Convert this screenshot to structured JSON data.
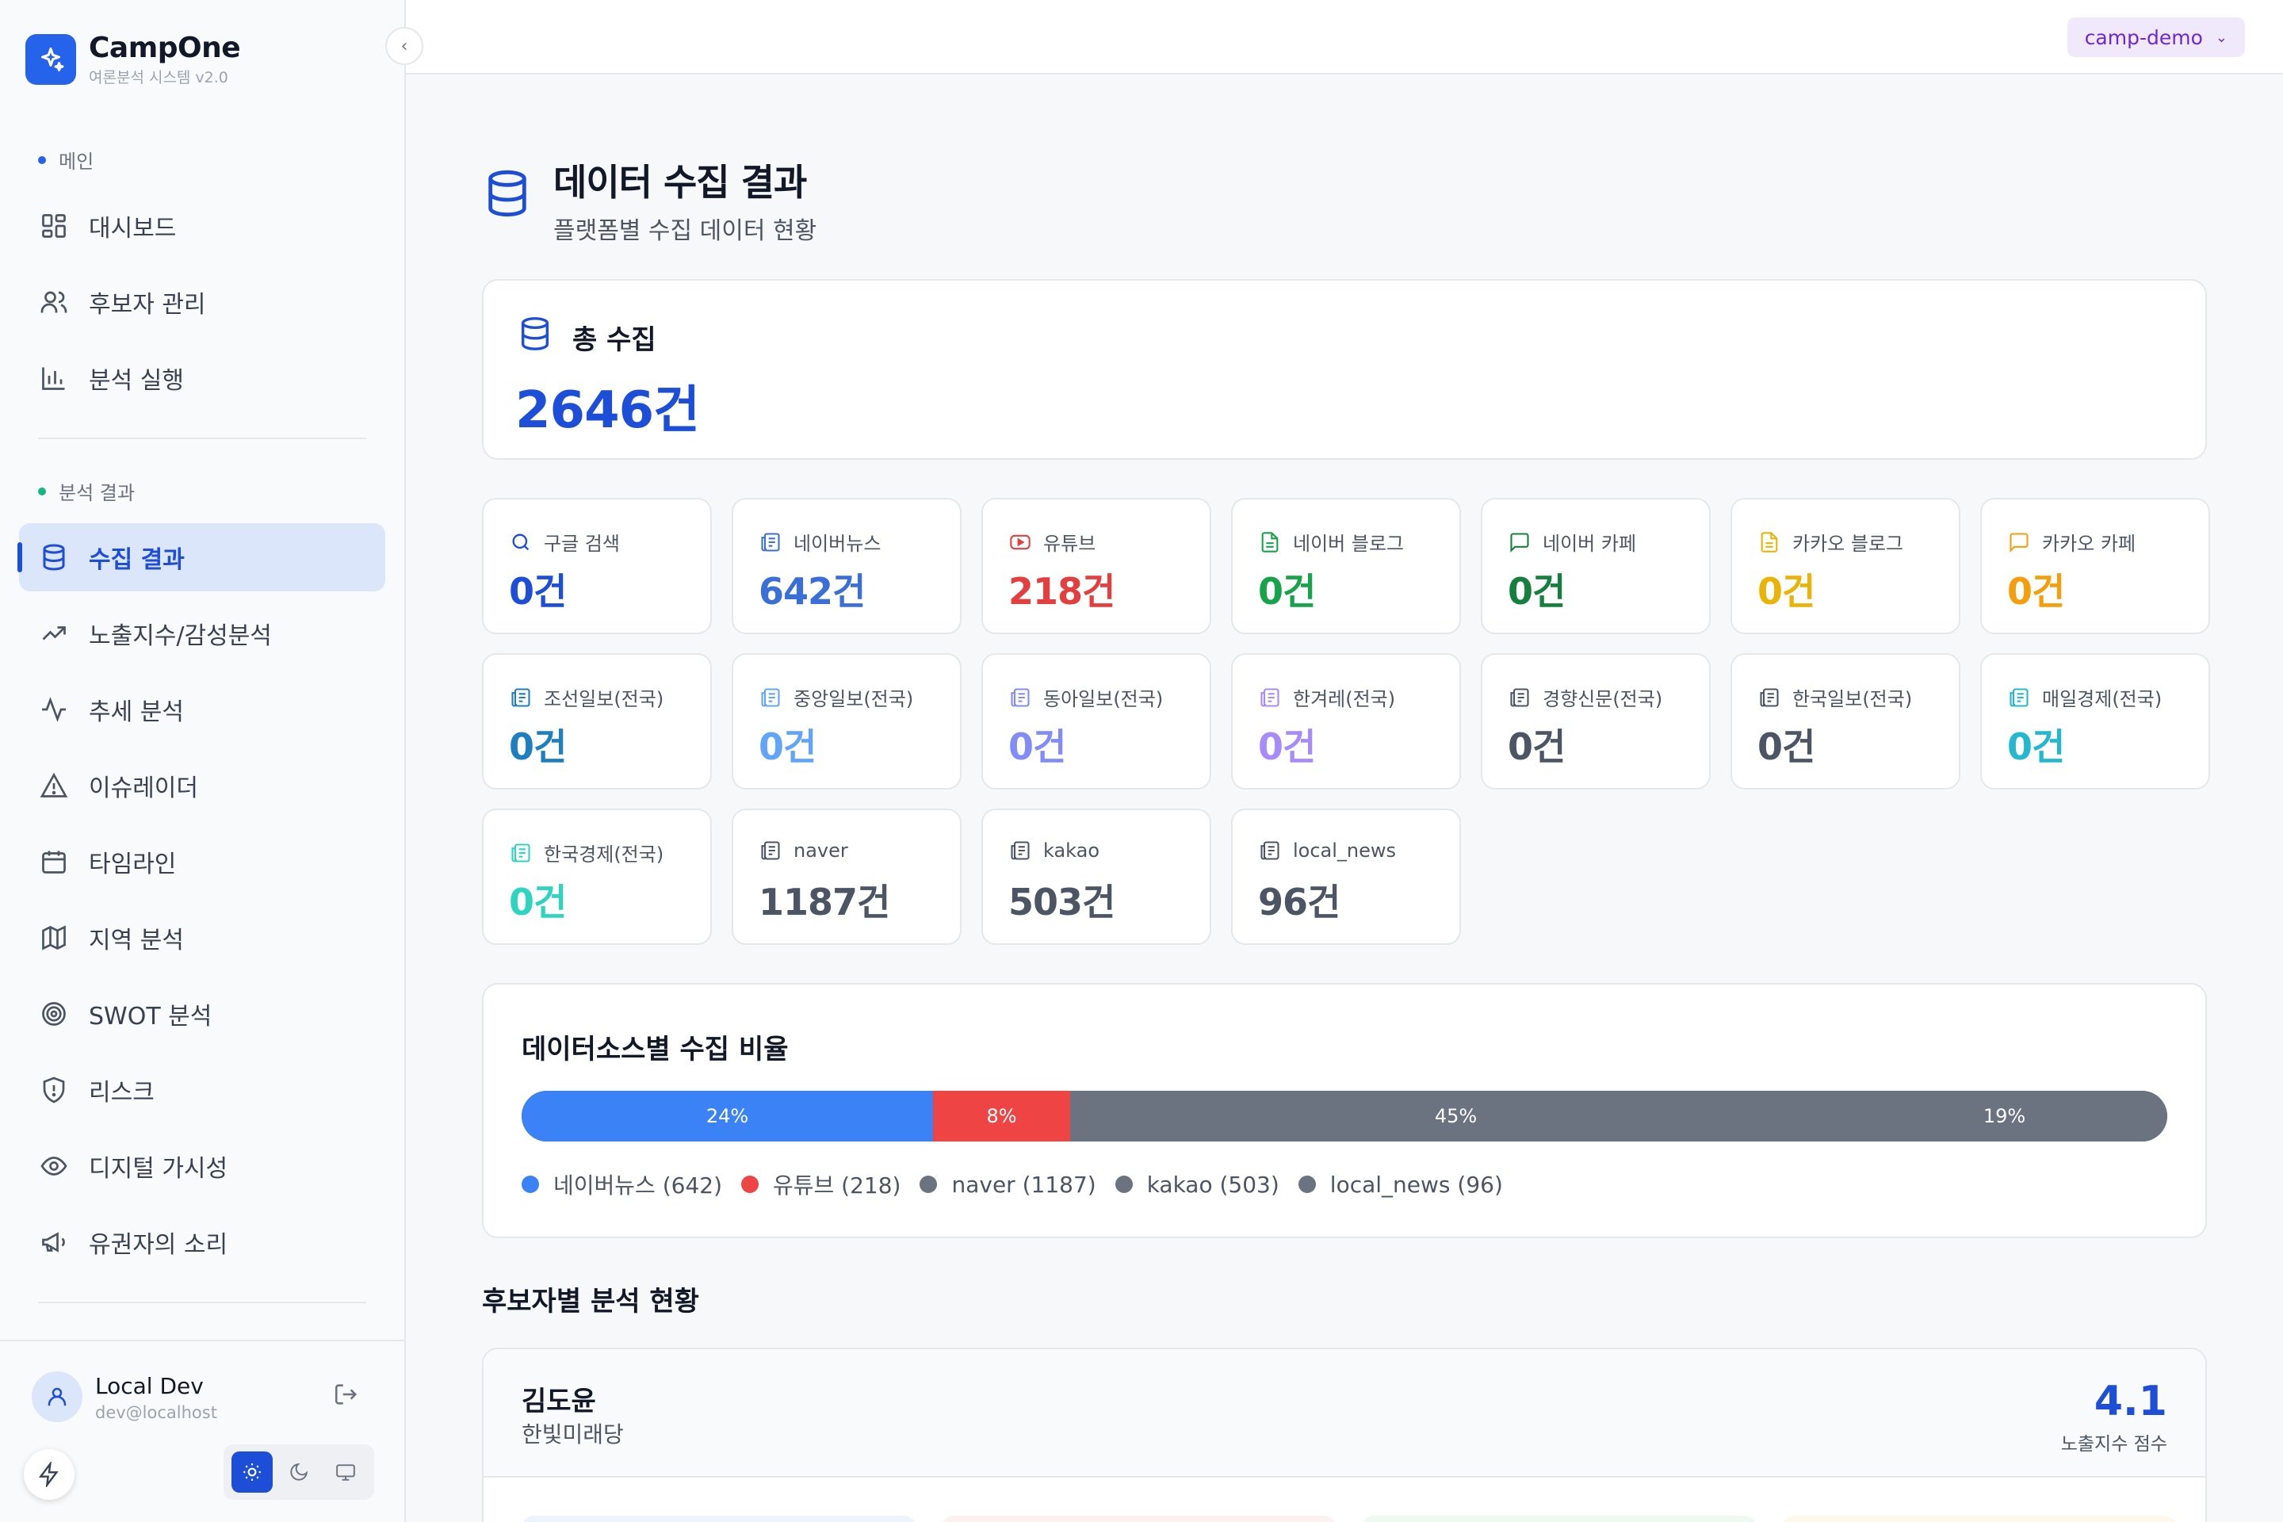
{
  "app": {
    "name": "CampOne",
    "subtitle": "여론분석 시스템 v2.0"
  },
  "sidebar": {
    "sections": [
      {
        "label": "메인",
        "color": "#2563eb"
      },
      {
        "label": "분석 결과",
        "color": "#10b981"
      }
    ],
    "items": [
      {
        "label": "대시보드",
        "icon": "layout-grid-icon"
      },
      {
        "label": "후보자 관리",
        "icon": "users-icon"
      },
      {
        "label": "분석 실행",
        "icon": "bar-chart-icon"
      },
      {
        "label": "수집 결과",
        "icon": "database-icon",
        "active": true
      },
      {
        "label": "노출지수/감성분석",
        "icon": "trending-up-icon"
      },
      {
        "label": "추세 분석",
        "icon": "activity-icon"
      },
      {
        "label": "이슈레이더",
        "icon": "alert-triangle-icon"
      },
      {
        "label": "타임라인",
        "icon": "calendar-icon"
      },
      {
        "label": "지역 분석",
        "icon": "map-icon"
      },
      {
        "label": "SWOT 분석",
        "icon": "target-icon"
      },
      {
        "label": "리스크",
        "icon": "shield-alert-icon"
      },
      {
        "label": "디지털 가시성",
        "icon": "eye-icon"
      },
      {
        "label": "유권자의 소리",
        "icon": "megaphone-icon"
      }
    ]
  },
  "user": {
    "name": "Local Dev",
    "email": "dev@localhost"
  },
  "topbar": {
    "project": "camp-demo"
  },
  "page": {
    "title": "데이터 수집 결과",
    "subtitle": "플랫폼별 수집 데이터 현황"
  },
  "total": {
    "label": "총 수집",
    "value": "2646건"
  },
  "sources": [
    {
      "label": "구글 검색",
      "value": "0건",
      "color": "#1d4ed8",
      "icon": "search-icon"
    },
    {
      "label": "네이버뉴스",
      "value": "642건",
      "color": "#3b6fd8",
      "icon": "newspaper-icon"
    },
    {
      "label": "유튜브",
      "value": "218건",
      "color": "#e53e3e",
      "icon": "youtube-icon"
    },
    {
      "label": "네이버 블로그",
      "value": "0건",
      "color": "#16a34a",
      "icon": "file-text-icon"
    },
    {
      "label": "네이버 카페",
      "value": "0건",
      "color": "#15803d",
      "icon": "message-square-icon"
    },
    {
      "label": "카카오 블로그",
      "value": "0건",
      "color": "#eab308",
      "icon": "file-text-icon"
    },
    {
      "label": "카카오 카페",
      "value": "0건",
      "color": "#f59e0b",
      "icon": "message-square-icon"
    },
    {
      "label": "조선일보(전국)",
      "value": "0건",
      "color": "#1e7fc0",
      "icon": "newspaper-icon"
    },
    {
      "label": "중앙일보(전국)",
      "value": "0건",
      "color": "#60a5fa",
      "icon": "newspaper-icon"
    },
    {
      "label": "동아일보(전국)",
      "value": "0건",
      "color": "#818cf8",
      "icon": "newspaper-icon"
    },
    {
      "label": "한겨레(전국)",
      "value": "0건",
      "color": "#a78bfa",
      "icon": "newspaper-icon"
    },
    {
      "label": "경향신문(전국)",
      "value": "0건",
      "color": "#4b5563",
      "icon": "newspaper-icon"
    },
    {
      "label": "한국일보(전국)",
      "value": "0건",
      "color": "#4b5563",
      "icon": "newspaper-icon"
    },
    {
      "label": "매일경제(전국)",
      "value": "0건",
      "color": "#22b8cf",
      "icon": "newspaper-icon"
    },
    {
      "label": "한국경제(전국)",
      "value": "0건",
      "color": "#2dd4bf",
      "icon": "newspaper-icon"
    },
    {
      "label": "naver",
      "value": "1187건",
      "color": "#4b5563",
      "icon": "newspaper-icon"
    },
    {
      "label": "kakao",
      "value": "503건",
      "color": "#4b5563",
      "icon": "newspaper-icon"
    },
    {
      "label": "local_news",
      "value": "96건",
      "color": "#4b5563",
      "icon": "newspaper-icon"
    }
  ],
  "ratio": {
    "title": "데이터소스별 수집 비율",
    "segments": [
      {
        "label": "24%",
        "value": 24,
        "color": "#3b82f6"
      },
      {
        "label": "8%",
        "value": 8,
        "color": "#ef4444"
      },
      {
        "label": "45%",
        "value": 45,
        "color": "#6b7280"
      },
      {
        "label": "19%",
        "value": 19,
        "color": "#6b7280"
      }
    ],
    "legend": [
      {
        "label": "네이버뉴스 (642)",
        "color": "#3b82f6"
      },
      {
        "label": "유튜브 (218)",
        "color": "#ef4444"
      },
      {
        "label": "naver (1187)",
        "color": "#6b7280"
      },
      {
        "label": "kakao (503)",
        "color": "#6b7280"
      },
      {
        "label": "local_news (96)",
        "color": "#6b7280"
      }
    ]
  },
  "candidates_section": {
    "title": "후보자별 분석 현황",
    "first": {
      "name": "김도윤",
      "party": "한빛미래당",
      "score": "4.1",
      "score_label": "노출지수 점수"
    }
  }
}
